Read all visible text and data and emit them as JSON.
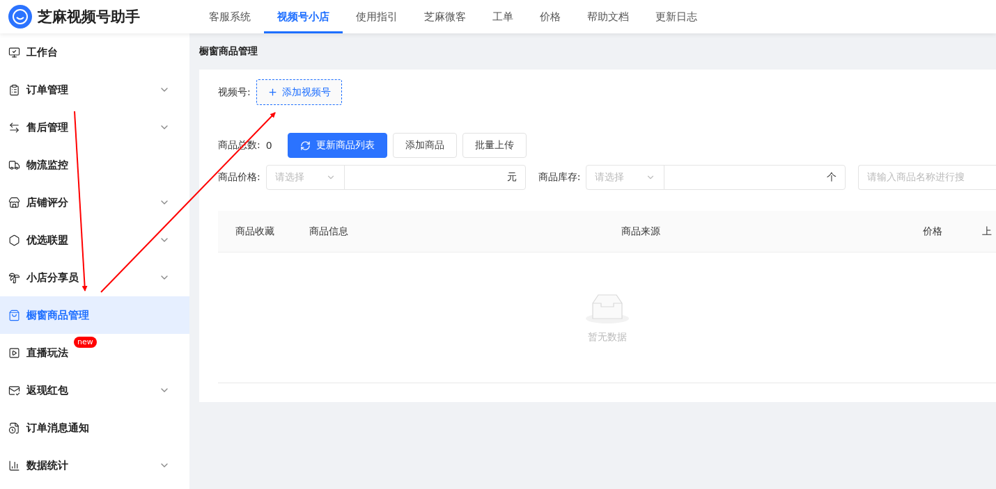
{
  "brand": {
    "name": "芝麻视频号助手"
  },
  "top_nav": [
    {
      "label": "客服系统",
      "selected": false
    },
    {
      "label": "视频号小店",
      "selected": true
    },
    {
      "label": "使用指引",
      "selected": false
    },
    {
      "label": "芝麻微客",
      "selected": false
    },
    {
      "label": "工单",
      "selected": false
    },
    {
      "label": "价格",
      "selected": false
    },
    {
      "label": "帮助文档",
      "selected": false
    },
    {
      "label": "更新日志",
      "selected": false
    }
  ],
  "sidebar": {
    "items": [
      {
        "label": "工作台",
        "expandable": false,
        "selected": false
      },
      {
        "label": "订单管理",
        "expandable": true,
        "selected": false
      },
      {
        "label": "售后管理",
        "expandable": true,
        "selected": false
      },
      {
        "label": "物流监控",
        "expandable": false,
        "selected": false
      },
      {
        "label": "店铺评分",
        "expandable": true,
        "selected": false
      },
      {
        "label": "优选联盟",
        "expandable": true,
        "selected": false
      },
      {
        "label": "小店分享员",
        "expandable": true,
        "selected": false
      },
      {
        "label": "橱窗商品管理",
        "expandable": false,
        "selected": true
      },
      {
        "label": "直播玩法",
        "expandable": false,
        "selected": false,
        "badge": "new"
      },
      {
        "label": "返现红包",
        "expandable": true,
        "selected": false
      },
      {
        "label": "订单消息通知",
        "expandable": false,
        "selected": false
      },
      {
        "label": "数据统计",
        "expandable": true,
        "selected": false
      }
    ]
  },
  "page_title": "橱窗商品管理",
  "channel": {
    "label": "视频号:",
    "add_button": "添加视频号"
  },
  "toolbar": {
    "count_label": "商品总数:",
    "count": "0",
    "buttons": [
      {
        "label": "更新商品列表",
        "kind": "primary"
      },
      {
        "label": "添加商品",
        "kind": "default"
      },
      {
        "label": "批量上传",
        "kind": "default"
      }
    ]
  },
  "filters": [
    {
      "label": "商品价格:",
      "placeholder": "请选择",
      "unit": "元"
    },
    {
      "label": "商品库存:",
      "placeholder": "请选择",
      "unit": "个"
    }
  ],
  "search": {
    "placeholder": "请输入商品名称进行搜"
  },
  "table": {
    "columns": [
      "商品收藏",
      "商品信息",
      "商品来源",
      "价格",
      "上"
    ],
    "empty_text": "暂无数据"
  }
}
